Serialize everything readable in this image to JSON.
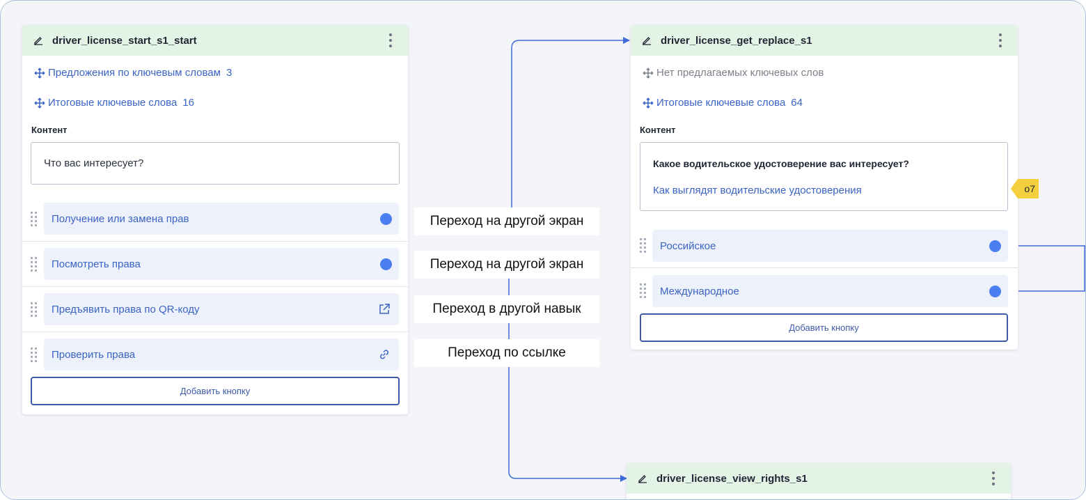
{
  "canvas": {
    "background": "#f4f5f9",
    "link_color": "#3f6bd8",
    "header_color": "#e3f4e6",
    "accent": "#3b63c4"
  },
  "cards": [
    {
      "title": "driver_license_start_s1_start",
      "keyword_suggestions": {
        "label": "Предложения по ключевым словам",
        "count": "3"
      },
      "final_keywords": {
        "label": "Итоговые ключевые слова",
        "count": "16"
      },
      "content_label": "Контент",
      "content_text": "Что вас интересует?",
      "buttons": [
        {
          "label": "Получение или замена прав",
          "icon": "dot-connector"
        },
        {
          "label": "Посмотреть права",
          "icon": "dot-connector"
        },
        {
          "label": "Предъявить права по QR-коду",
          "icon": "external-link-icon"
        },
        {
          "label": "Проверить права",
          "icon": "link-icon"
        }
      ],
      "add_button": "Добавить кнопку"
    },
    {
      "title": "driver_license_get_replace_s1",
      "keyword_suggestions": {
        "label": "Нет предлагаемых ключевых слов"
      },
      "final_keywords": {
        "label": "Итоговые ключевые слова",
        "count": "64"
      },
      "content_label": "Контент",
      "content_title": "Какое водительское удостоверение вас интересует?",
      "content_link": "Как выглядят водительские удостоверения",
      "badge": "о7",
      "buttons": [
        {
          "label": "Российское",
          "icon": "dot-connector"
        },
        {
          "label": "Международное",
          "icon": "dot-connector"
        }
      ],
      "add_button": "Добавить кнопку"
    },
    {
      "title": "driver_license_view_rights_s1"
    }
  ],
  "transitions": [
    "Переход на другой экран",
    "Переход на другой экран",
    "Переход в другой навык",
    "Переход по ссылке"
  ]
}
